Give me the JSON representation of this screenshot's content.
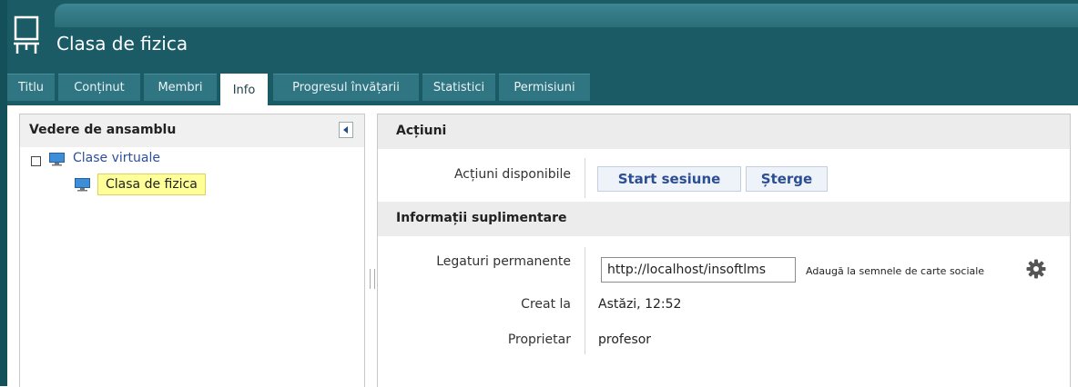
{
  "header": {
    "title": "Clasa de fizica",
    "icon": "whiteboard-icon"
  },
  "tabs": [
    {
      "label": "Titlu",
      "active": false
    },
    {
      "label": "Conținut",
      "active": false
    },
    {
      "label": "Membri",
      "active": false
    },
    {
      "label": "Info",
      "active": true
    },
    {
      "label": "Progresul învățarii",
      "active": false
    },
    {
      "label": "Statistici",
      "active": false
    },
    {
      "label": "Permisiuni",
      "active": false
    }
  ],
  "left_panel": {
    "title": "Vedere de ansamblu",
    "collapse_icon": "collapse-left-icon",
    "tree": {
      "root_label": "Clase virtuale",
      "child_label": "Clasa de fizica"
    }
  },
  "actions_section": {
    "title": "Acțiuni",
    "available_label": "Acțiuni disponibile",
    "start_button": "Start sesiune",
    "delete_button": "Șterge"
  },
  "info_section": {
    "title": "Informații suplimentare",
    "permalink_label": "Legaturi permanente",
    "permalink_value": "http://localhost/insoftlms",
    "social_label": "Adaugă la semnele de carte sociale",
    "social_icon": "gear-icon",
    "created_label": "Creat la",
    "created_value": "Astăzi, 12:52",
    "owner_label": "Proprietar",
    "owner_value": "profesor"
  },
  "colors": {
    "header_bg": "#1b5b66",
    "tab_bg": "#2f7582",
    "link": "#2d4e9a",
    "selected_bg": "#ffff99"
  }
}
